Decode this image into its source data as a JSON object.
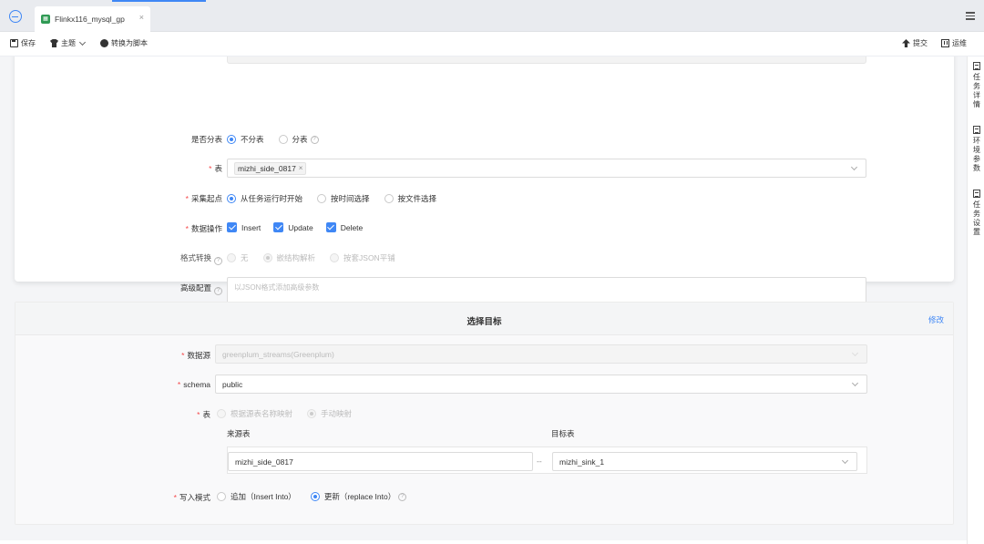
{
  "tabbar": {
    "tab_title": "Flinkx116_mysql_gp",
    "close_glyph": "×"
  },
  "toolbar": {
    "save_label": "保存",
    "theme_label": "主题",
    "convert_label": "转换为脚本",
    "submit_label": "提交",
    "ops_label": "运维"
  },
  "right_sidebar": {
    "items": [
      {
        "label": "任务详情",
        "icon": "document-icon"
      },
      {
        "label": "环境参数",
        "icon": "grid-icon"
      },
      {
        "label": "任务设置",
        "icon": "settings-doc-icon"
      }
    ]
  },
  "source": {
    "split_table": {
      "label": "是否分表",
      "options": [
        "不分表",
        "分表"
      ],
      "selected": "不分表"
    },
    "table": {
      "label": "表",
      "value": "mizhi_side_0817",
      "remove_glyph": "×"
    },
    "collect_start": {
      "label": "采集起点",
      "options": [
        "从任务运行时开始",
        "按时间选择",
        "按文件选择"
      ],
      "selected": "从任务运行时开始"
    },
    "data_ops": {
      "label": "数据操作",
      "options": [
        "Insert",
        "Update",
        "Delete"
      ]
    },
    "format_convert": {
      "label": "格式转换",
      "options": [
        "无",
        "嵌结构解析",
        "按套JSON平铺"
      ],
      "selected": "嵌结构解析"
    },
    "advanced": {
      "label": "高级配置",
      "placeholder": "以JSON格式添加高级参数"
    }
  },
  "target": {
    "title": "选择目标",
    "edit_label": "修改",
    "datasource": {
      "label": "数据源",
      "value": "greenplum_streams(Greenplum)"
    },
    "schema": {
      "label": "schema",
      "value": "public"
    },
    "table": {
      "label": "表",
      "options": [
        "根据源表名称映射",
        "手动映射"
      ],
      "selected": "手动映射"
    },
    "mapping": {
      "source_header": "来源表",
      "target_header": "目标表",
      "source_value": "mizhi_side_0817",
      "separator": "--",
      "target_value": "mizhi_sink_1"
    },
    "write_mode": {
      "label": "写入模式",
      "options": [
        "追加（Insert Into）",
        "更新（replace Into）"
      ],
      "selected": "更新（replace Into）"
    }
  },
  "colors": {
    "accent": "#3f87f5",
    "required": "#f5484a",
    "tab_icon": "#2f9a54"
  }
}
